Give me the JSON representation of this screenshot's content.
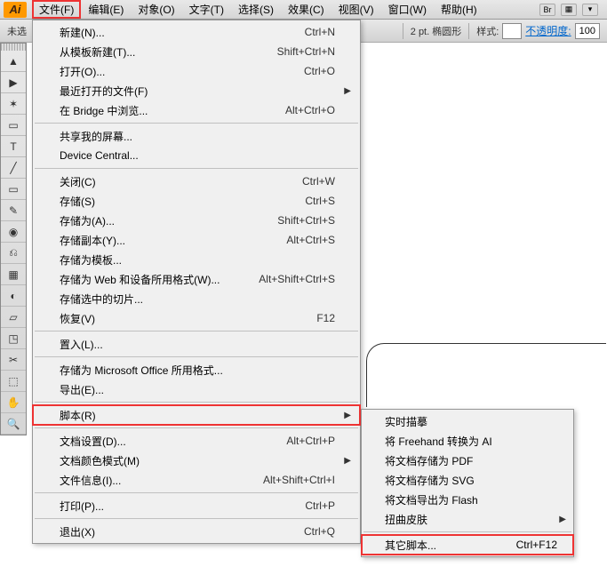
{
  "app_icon": "Ai",
  "menubar": {
    "items": [
      "文件(F)",
      "编辑(E)",
      "对象(O)",
      "文字(T)",
      "选择(S)",
      "效果(C)",
      "视图(V)",
      "窗口(W)",
      "帮助(H)"
    ],
    "right": {
      "br": "Br",
      "grid": "▦",
      "down": "▾"
    }
  },
  "toolbar": {
    "left_label": "未选",
    "stroke_label": "2 pt. 椭圆形",
    "style_label": "样式:",
    "opacity_label": "不透明度:",
    "opacity_value": "100"
  },
  "file_menu": [
    {
      "label": "新建(N)...",
      "short": "Ctrl+N"
    },
    {
      "label": "从模板新建(T)...",
      "short": "Shift+Ctrl+N"
    },
    {
      "label": "打开(O)...",
      "short": "Ctrl+O"
    },
    {
      "label": "最近打开的文件(F)",
      "arrow": true
    },
    {
      "label": "在 Bridge 中浏览...",
      "short": "Alt+Ctrl+O"
    },
    {
      "sep": true
    },
    {
      "label": "共享我的屏幕..."
    },
    {
      "label": "Device Central..."
    },
    {
      "sep": true
    },
    {
      "label": "关闭(C)",
      "short": "Ctrl+W"
    },
    {
      "label": "存储(S)",
      "short": "Ctrl+S"
    },
    {
      "label": "存储为(A)...",
      "short": "Shift+Ctrl+S"
    },
    {
      "label": "存储副本(Y)...",
      "short": "Alt+Ctrl+S"
    },
    {
      "label": "存储为模板..."
    },
    {
      "label": "存储为 Web 和设备所用格式(W)...",
      "short": "Alt+Shift+Ctrl+S"
    },
    {
      "label": "存储选中的切片..."
    },
    {
      "label": "恢复(V)",
      "short": "F12"
    },
    {
      "sep": true
    },
    {
      "label": "置入(L)..."
    },
    {
      "sep": true
    },
    {
      "label": "存储为 Microsoft Office 所用格式..."
    },
    {
      "label": "导出(E)..."
    },
    {
      "sep": true
    },
    {
      "label": "脚本(R)",
      "arrow": true,
      "hl": true
    },
    {
      "sep": true
    },
    {
      "label": "文档设置(D)...",
      "short": "Alt+Ctrl+P"
    },
    {
      "label": "文档颜色模式(M)",
      "arrow": true
    },
    {
      "label": "文件信息(I)...",
      "short": "Alt+Shift+Ctrl+I"
    },
    {
      "sep": true
    },
    {
      "label": "打印(P)...",
      "short": "Ctrl+P"
    },
    {
      "sep": true
    },
    {
      "label": "退出(X)",
      "short": "Ctrl+Q"
    }
  ],
  "script_submenu": [
    {
      "label": "实时描摹"
    },
    {
      "label": "将 Freehand 转换为 AI"
    },
    {
      "label": "将文档存储为 PDF"
    },
    {
      "label": "将文档存储为 SVG"
    },
    {
      "label": "将文档导出为 Flash"
    },
    {
      "label": "扭曲皮肤",
      "arrow": true
    },
    {
      "sep": true
    },
    {
      "label": "其它脚本...",
      "short": "Ctrl+F12",
      "hl": true
    }
  ],
  "tools": [
    "▲",
    "▶",
    "✶",
    "▭",
    "T",
    "╱",
    "▭",
    "✎",
    "◉",
    "⎌",
    "▦",
    "◐",
    "▱",
    "◳",
    "✂",
    "⬚",
    "✋",
    "🔍"
  ]
}
